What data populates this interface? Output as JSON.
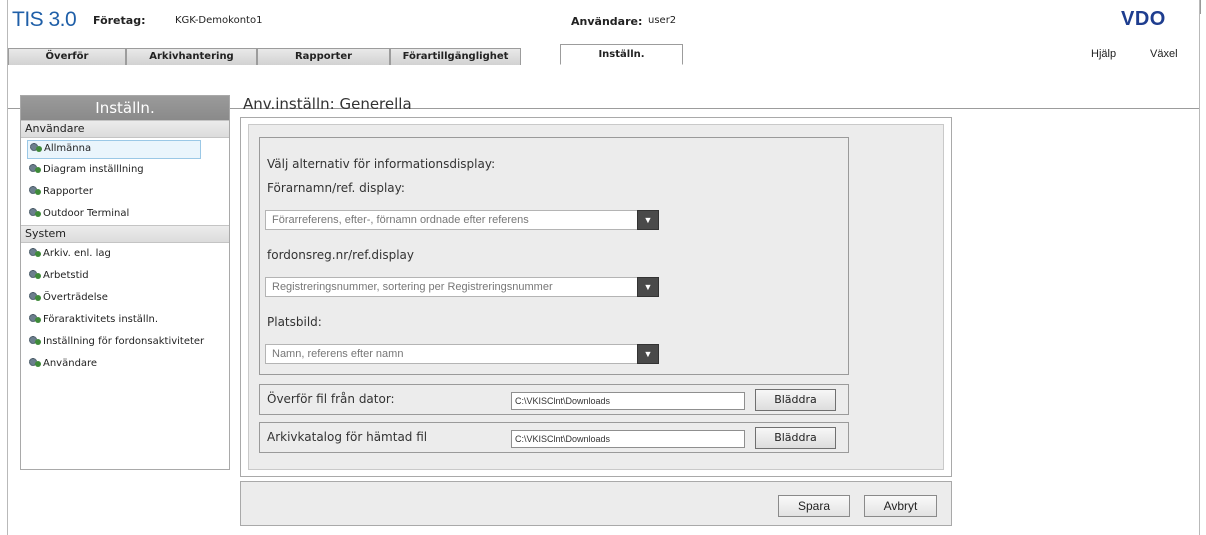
{
  "header": {
    "logo": "TIS 3.0",
    "company_label": "Företag:",
    "company_value": "KGK-Demokonto1",
    "user_label": "Användare:",
    "user_value": "user2",
    "brand": "VDO"
  },
  "tabs": [
    {
      "label": "Överför"
    },
    {
      "label": "Arkivhantering"
    },
    {
      "label": "Rapporter"
    },
    {
      "label": "Förartillgänglighet"
    },
    {
      "label": "Inställn.",
      "active": true
    }
  ],
  "top_links": {
    "help": "Hjälp",
    "switch": "Växel"
  },
  "sidebar": {
    "title": "Inställn.",
    "sections": [
      {
        "label": "Användare",
        "items": [
          {
            "label": "Allmänna",
            "active": true
          },
          {
            "label": "Diagram inställlning"
          },
          {
            "label": "Rapporter"
          },
          {
            "label": "Outdoor Terminal"
          }
        ]
      },
      {
        "label": "System",
        "items": [
          {
            "label": "Arkiv. enl. lag"
          },
          {
            "label": "Arbetstid"
          },
          {
            "label": "Överträdelse"
          },
          {
            "label": "Föraraktivitets inställn."
          },
          {
            "label": "Inställning för fordonsaktiviteter"
          },
          {
            "label": "Användare"
          }
        ]
      }
    ],
    "icon": "gear-icon"
  },
  "main": {
    "title": "Anv.inställn: Generella",
    "display_options": {
      "heading": "Välj alternativ för informationsdisplay:",
      "driver_label": "Förarnamn/ref. display:",
      "driver_value": "Förarreferens, efter-, förnamn ordnade efter referens",
      "vehicle_label": "fordonsreg.nr/ref.display",
      "vehicle_value": "Registreringsnummer, sortering per Registreringsnummer",
      "location_label": "Platsbild:",
      "location_value": "Namn, referens efter namn"
    },
    "upload": {
      "label": "Överför fil från dator:",
      "path": "C:\\VKISClnt\\Downloads",
      "browse": "Bläddra"
    },
    "archive": {
      "label": "Arkivkatalog för hämtad fil",
      "path": "C:\\VKISClnt\\Downloads",
      "browse": "Bläddra"
    },
    "save": "Spara",
    "cancel": "Avbryt"
  }
}
